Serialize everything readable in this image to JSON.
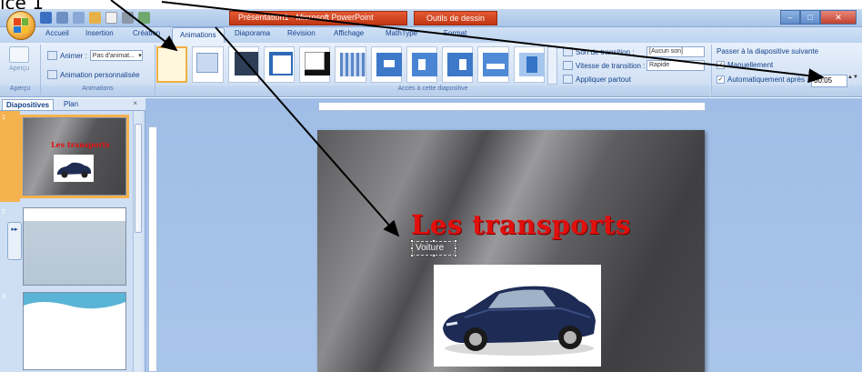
{
  "caption": "ice 1",
  "window": {
    "title": "Présentation1 - Microsoft PowerPoint",
    "context_tab": "Outils de dessin",
    "controls": {
      "minimize": "–",
      "maximize": "□",
      "close": "✕"
    }
  },
  "tabs": [
    {
      "label": "Accueil"
    },
    {
      "label": "Insertion"
    },
    {
      "label": "Création"
    },
    {
      "label": "Animations"
    },
    {
      "label": "Diaporama"
    },
    {
      "label": "Révision"
    },
    {
      "label": "Affichage"
    },
    {
      "label": "MathType"
    },
    {
      "label": "Format"
    }
  ],
  "ribbon": {
    "apercu": {
      "button_label": "Aperçu",
      "group_label": "Aperçu"
    },
    "animations": {
      "animer_label": "Animer :",
      "animer_value": "Pas d'animat...",
      "custom_label": "Animation personnalisée",
      "group_label": "Animations"
    },
    "transition": {
      "group_label": "Accès à cette diapositive",
      "sound_label": "Son de transition :",
      "sound_value": "[Aucun son]",
      "speed_label": "Vitesse de transition :",
      "speed_value": "Rapide",
      "apply_all_label": "Appliquer partout"
    },
    "advance": {
      "title": "Passer à la diapositive suivante",
      "on_click_label": "Manuellement",
      "on_click_checked": "✓",
      "auto_label": "Automatiquement après :",
      "auto_checked": "✓",
      "auto_value": "00:05",
      "spin": "▲▼"
    }
  },
  "pane": {
    "tabs": [
      {
        "label": "Diapositives"
      },
      {
        "label": "Plan"
      }
    ],
    "close": "×",
    "slides": [
      {
        "number": "1",
        "title": "Les transports"
      },
      {
        "number": "2"
      },
      {
        "number": "3"
      }
    ],
    "collapse_label": "▸▸"
  },
  "slide": {
    "title": "Les transports",
    "subtitle": "Voiture"
  },
  "colors": {
    "title_red": "#e1100d",
    "selection_orange": "#f4b24f",
    "ribbon_blue": "#15428b"
  }
}
